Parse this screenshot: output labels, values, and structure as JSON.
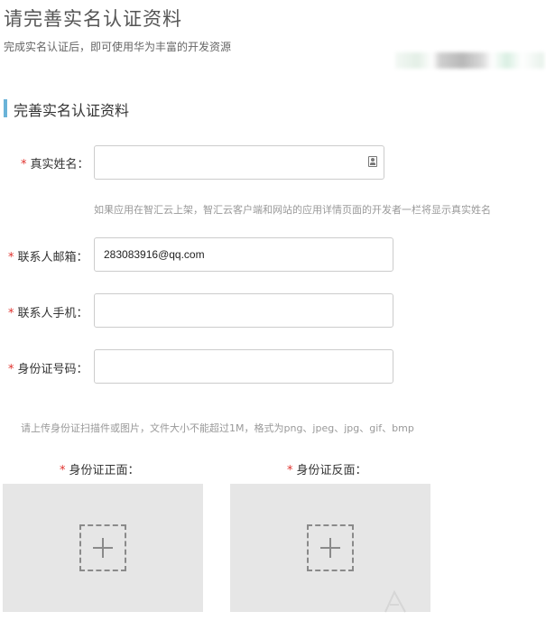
{
  "header": {
    "title": "请完善实名认证资料",
    "subtitle": "完成实名认证后，即可使用华为丰富的开发资源"
  },
  "section": {
    "title": "完善实名认证资料"
  },
  "form": {
    "real_name": {
      "label": "真实姓名：",
      "value": "",
      "icon": "contact-card-icon"
    },
    "real_name_hint": "如果应用在智汇云上架，智汇云客户端和网站的应用详情页面的开发者一栏将显示真实姓名",
    "email": {
      "label": "联系人邮箱：",
      "value": "283083916@qq.com"
    },
    "phone": {
      "label": "联系人手机：",
      "value": ""
    },
    "id_number": {
      "label": "身份证号码：",
      "value": ""
    },
    "upload_hint": "请上传身份证扫描件或图片，文件大小不能超过1M，格式为png、jpeg、jpg、gif、bmp",
    "id_front": {
      "label": "身份证正面：",
      "icon": "add-image-icon"
    },
    "id_back": {
      "label": "身份证反面：",
      "icon": "add-image-icon"
    },
    "required_mark": "*"
  },
  "colors": {
    "required": "#e0312c",
    "section_accent": "#6ab3d8",
    "upload_bg": "#e6e6e6",
    "border": "#cccccc"
  }
}
